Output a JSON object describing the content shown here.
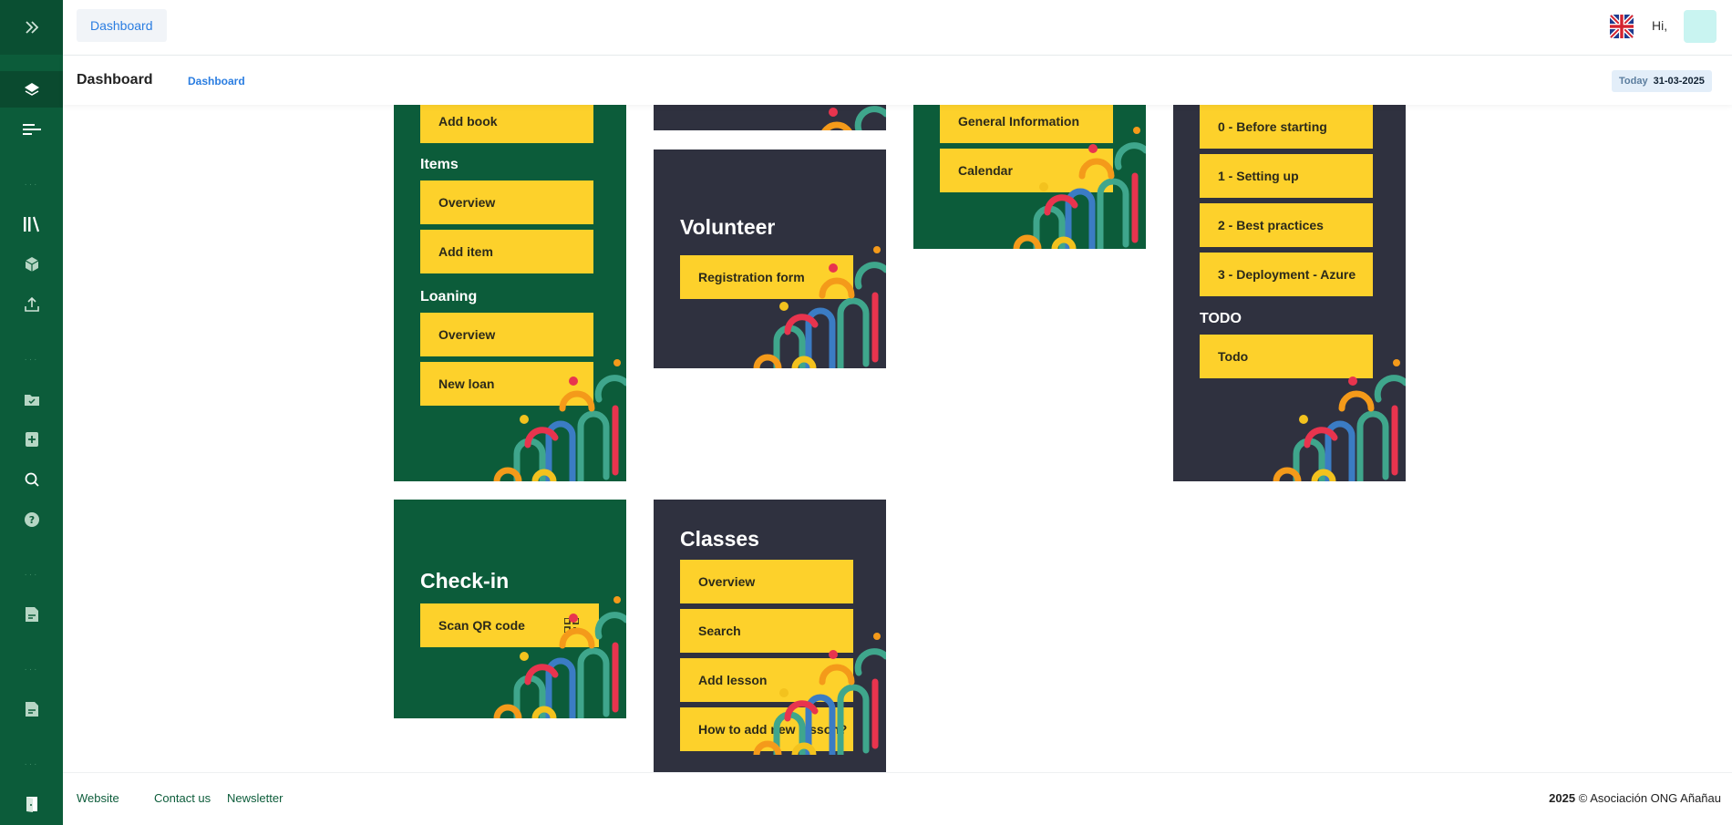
{
  "header": {
    "breadcrumb_button": "Dashboard",
    "greeting": "Hi,",
    "language_icon": "uk-flag-icon"
  },
  "subheader": {
    "title": "Dashboard",
    "crumb": "Dashboard",
    "date_label": "Today",
    "date_value": "31-03-2025"
  },
  "sidebar": {
    "icons": [
      "expand-chevrons-icon",
      "layers-icon",
      "menu-lines-icon",
      "library-icon",
      "box-icon",
      "upload-icon",
      "checked-folder-icon",
      "add-document-icon",
      "search-icon",
      "help-icon",
      "document-icon",
      "document-icon",
      "logout-icon"
    ]
  },
  "cards": {
    "books": {
      "add_book": "Add book",
      "items_heading": "Items",
      "items_overview": "Overview",
      "add_item": "Add item",
      "loaning_heading": "Loaning",
      "loaning_overview": "Overview",
      "new_loan": "New loan"
    },
    "volunteer": {
      "title": "Volunteer",
      "registration": "Registration form"
    },
    "info": {
      "general": "General Information",
      "calendar": "Calendar"
    },
    "docs": {
      "b0": "0 - Before starting",
      "b1": "1 - Setting up",
      "b2": "2 - Best practices",
      "b3": "3 - Deployment - Azure",
      "todo_heading": "TODO",
      "todo": "Todo"
    },
    "checkin": {
      "title": "Check-in",
      "scan": "Scan QR code"
    },
    "classes": {
      "title": "Classes",
      "overview": "Overview",
      "search": "Search",
      "add_lesson": "Add lesson",
      "how_to": "How to add new lesson?"
    }
  },
  "footer": {
    "website": "Website",
    "contact": "Contact us",
    "newsletter": "Newsletter",
    "year": "2025",
    "copyright": "©  Asociación ONG Añañau"
  },
  "colors": {
    "sidebar_green": "#0c5c3a",
    "card_dark": "#2f313f",
    "button_yellow": "#fdd12b",
    "link_blue": "#2a7de1"
  }
}
